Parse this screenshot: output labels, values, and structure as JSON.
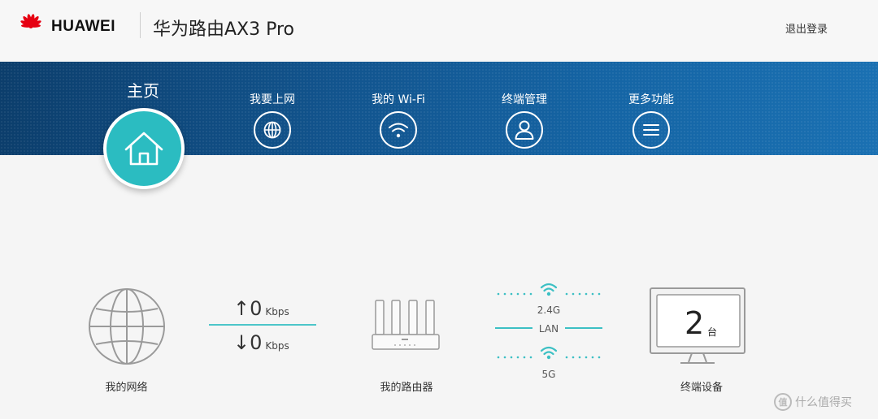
{
  "header": {
    "brand": "HUAWEI",
    "product": "华为路由AX3 Pro",
    "logout": "退出登录"
  },
  "nav": {
    "home": "主页",
    "items": [
      {
        "label": "我要上网",
        "icon": "globe-icon"
      },
      {
        "label": "我的 Wi-Fi",
        "icon": "wifi-icon"
      },
      {
        "label": "终端管理",
        "icon": "user-icon"
      },
      {
        "label": "更多功能",
        "icon": "menu-icon"
      }
    ]
  },
  "status": {
    "network_label": "我的网络",
    "upload_arrow": "↑",
    "upload_value": "0",
    "upload_unit": "Kbps",
    "download_arrow": "↓",
    "download_value": "0",
    "download_unit": "Kbps",
    "router_label": "我的路由器",
    "band_24": "2.4G",
    "band_lan": "LAN",
    "band_5g": "5G",
    "device_count": "2",
    "device_unit": "台",
    "terminal_label": "终端设备"
  },
  "watermark": {
    "badge": "值",
    "text": "什么值得买"
  },
  "colors": {
    "accent": "#2bbcc1",
    "nav_dark": "#0c3e6c",
    "nav_light": "#1a70b2",
    "brand_red": "#e60012"
  }
}
